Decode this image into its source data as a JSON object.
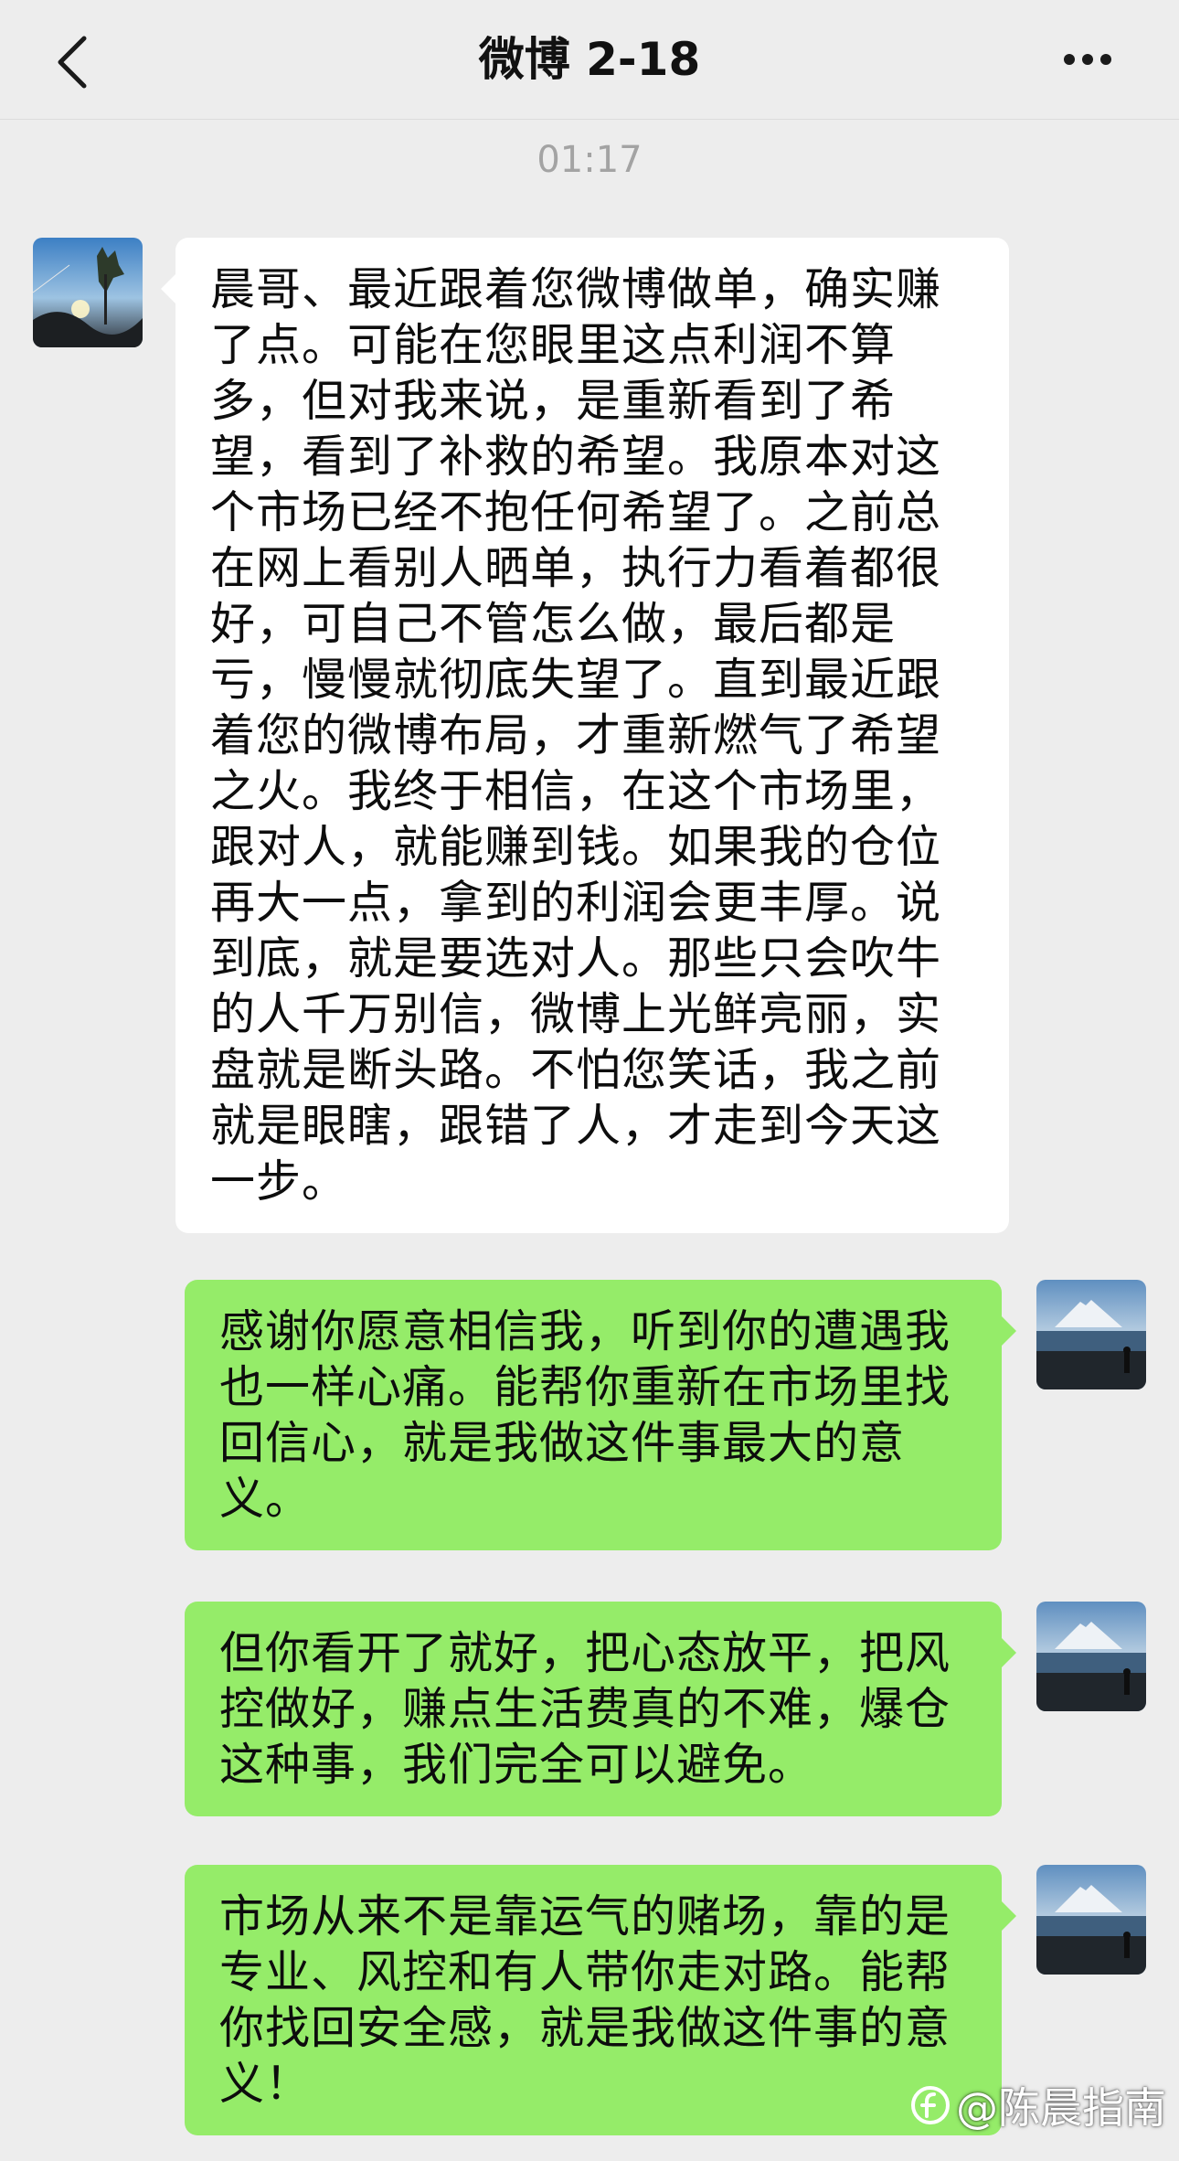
{
  "header": {
    "title": "微博 2-18",
    "back_icon": "chevron-left-icon",
    "more_icon": "more-dots-icon"
  },
  "timestamp": "01:17",
  "colors": {
    "background": "#ededed",
    "incoming_bubble": "#ffffff",
    "outgoing_bubble": "#95ec69"
  },
  "messages": [
    {
      "direction": "incoming",
      "text": "晨哥、最近跟着您微博做单，确实赚了点。可能在您眼里这点利润不算多，但对我来说，是重新看到了希望，看到了补救的希望。我原本对这个市场已经不抱任何希望了。之前总在网上看别人晒单，执行力看着都很好，可自己不管怎么做，最后都是亏，慢慢就彻底失望了。直到最近跟着您的微博布局，才重新燃气了希望之火。我终于相信，在这个市场里，跟对人，就能赚到钱。如果我的仓位再大一点，拿到的利润会更丰厚。说到底，就是要选对人。那些只会吹牛的人千万别信，微博上光鲜亮丽，实盘就是断头路。不怕您笑话，我之前就是眼瞎，跟错了人，才走到今天这一步。"
    },
    {
      "direction": "outgoing",
      "text": "感谢你愿意相信我，听到你的遭遇我也一样心痛。能帮你重新在市场里找回信心，就是我做这件事最大的意义。"
    },
    {
      "direction": "outgoing",
      "text": "但你看开了就好，把心态放平，把风控做好，赚点生活费真的不难，爆仓这种事，我们完全可以避免。"
    },
    {
      "direction": "outgoing",
      "text": "市场从来不是靠运气的赌场，靠的是专业、风控和有人带你走对路。能帮你找回安全感，就是我做这件事的意义！"
    }
  ],
  "watermark": {
    "text": "@陈晨指南"
  }
}
